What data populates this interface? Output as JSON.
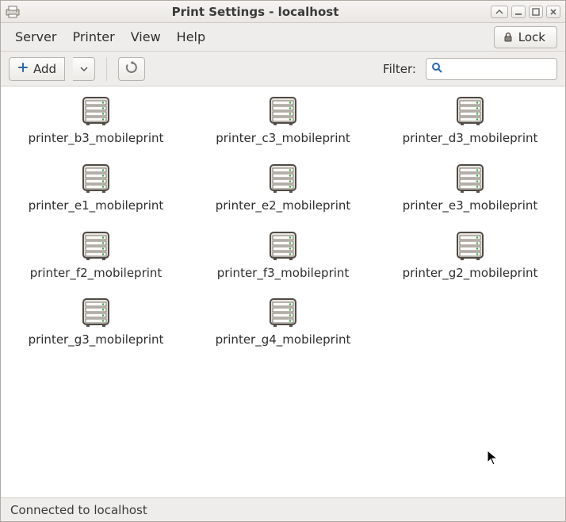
{
  "titlebar": {
    "title": "Print Settings - localhost"
  },
  "menubar": {
    "items": [
      "Server",
      "Printer",
      "View",
      "Help"
    ],
    "lock_label": "Lock"
  },
  "toolbar": {
    "add_label": "Add",
    "filter_label": "Filter:",
    "search_value": "",
    "search_placeholder": ""
  },
  "printers": [
    "printer_b3_mobileprint",
    "printer_c3_mobileprint",
    "printer_d3_mobileprint",
    "printer_e1_mobileprint",
    "printer_e2_mobileprint",
    "printer_e3_mobileprint",
    "printer_f2_mobileprint",
    "printer_f3_mobileprint",
    "printer_g2_mobileprint",
    "printer_g3_mobileprint",
    "printer_g4_mobileprint"
  ],
  "statusbar": {
    "text": "Connected to localhost"
  }
}
